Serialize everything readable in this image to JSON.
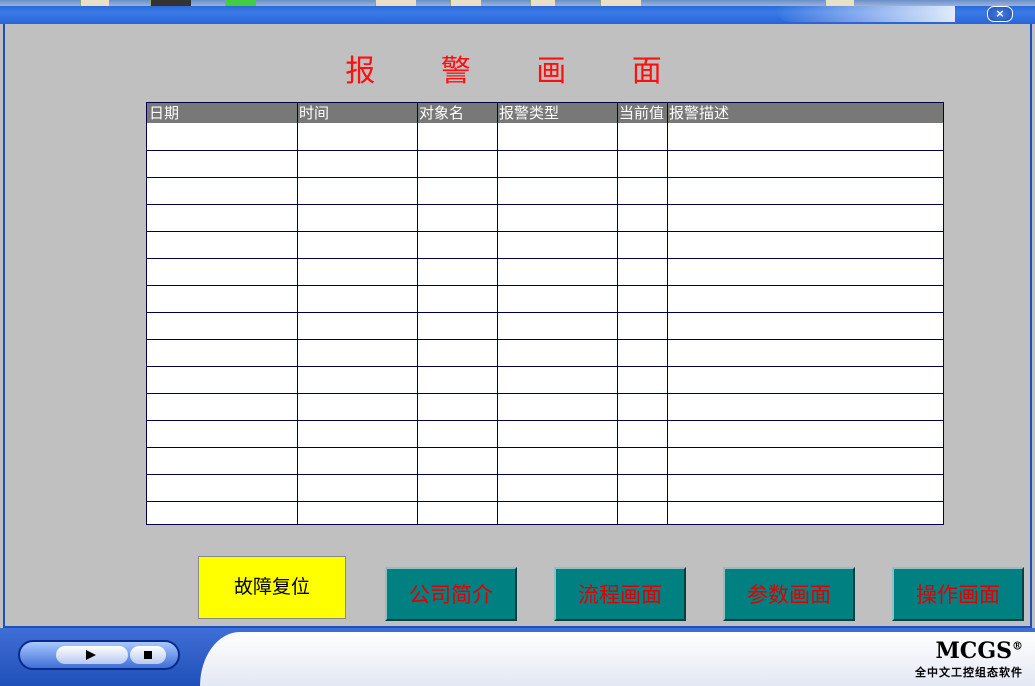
{
  "page": {
    "title": "报 警 画 面"
  },
  "table": {
    "headers": [
      "日期",
      "时间",
      "对象名",
      "报警类型",
      "当前值",
      "报警描述"
    ],
    "row_count": 15
  },
  "buttons": {
    "reset": "故障复位",
    "company": "公司简介",
    "flow": "流程画面",
    "param": "参数画面",
    "operate": "操作画面"
  },
  "titlebar": {
    "close": "×"
  },
  "brand": {
    "name": "MCGS",
    "mark": "®",
    "tagline": "全中文工控组态软件"
  },
  "colors": {
    "title": "#ff1010",
    "reset_button": "#ffff00",
    "nav_button": "#008080",
    "nav_text": "#e00000",
    "header_row": "#787878"
  }
}
